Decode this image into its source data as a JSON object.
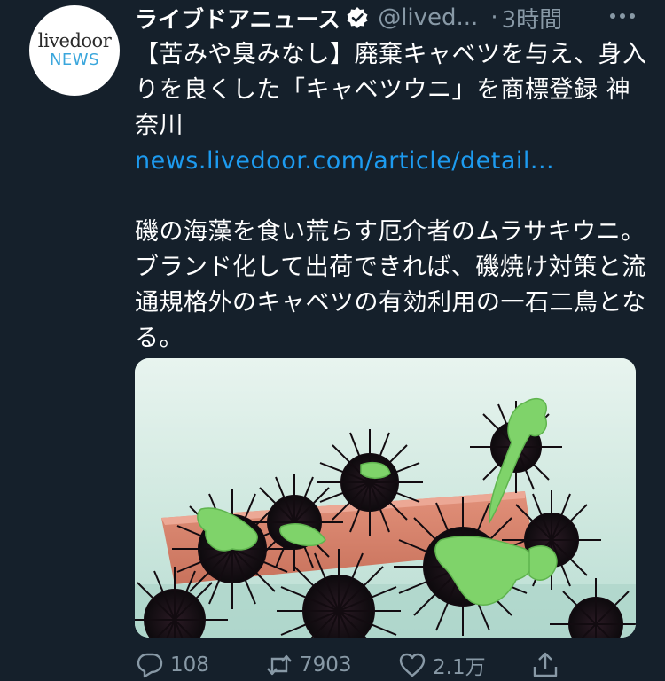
{
  "tweet": {
    "display_name": "ライブドアニュース",
    "handle": "@lived...",
    "separator": "·",
    "time": "3時間",
    "avatar": {
      "top_text": "livedoor",
      "bottom_text": "NEWS"
    },
    "headline": "【苦みや臭みなし】廃棄キャベツを与え、身入りを良くした「キャベツウニ」を商標登録 神奈川",
    "link": "news.livedoor.com/article/detail...",
    "summary": "磯の海藻を食い荒らす厄介者のムラサキウニ。ブランド化して出荷できれば、磯焼け対策と流通規格外のキャベツの有効利用の一石二鳥となる。",
    "media_alt": "sea urchins with cabbage leaves in a tank",
    "actions": {
      "replies": "108",
      "retweets": "7903",
      "likes": "2.1万"
    }
  },
  "colors": {
    "background": "#15202b",
    "text": "#ffffff",
    "muted": "#8899a6",
    "link": "#1d9bf0",
    "logo_blue": "#3aa6dc"
  }
}
